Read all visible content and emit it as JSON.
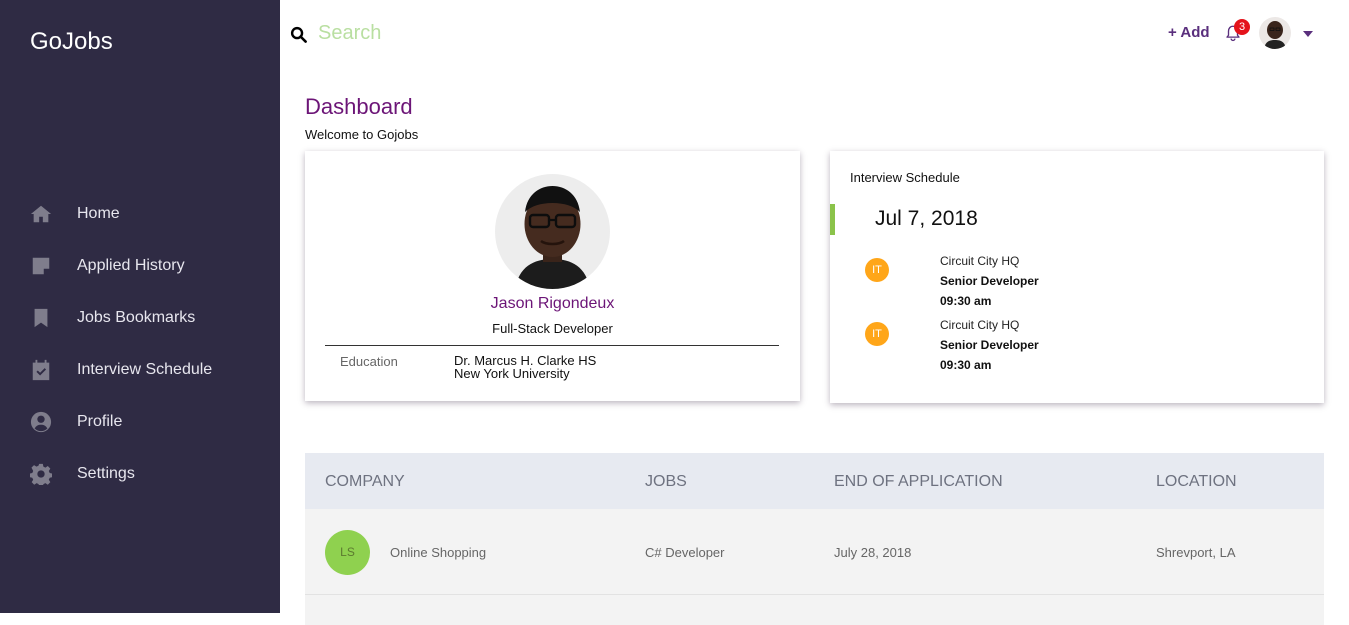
{
  "brand": "GoJobs",
  "nav": [
    {
      "label": "Home",
      "icon": "home-icon"
    },
    {
      "label": "Applied History",
      "icon": "note-icon"
    },
    {
      "label": "Jobs Bookmarks",
      "icon": "bookmark-icon"
    },
    {
      "label": "Interview Schedule",
      "icon": "calendar-check-icon"
    },
    {
      "label": "Profile",
      "icon": "account-icon"
    },
    {
      "label": "Settings",
      "icon": "gear-icon"
    }
  ],
  "topbar": {
    "search_placeholder": "Search",
    "add_label": "+ Add",
    "notification_count": "3"
  },
  "page": {
    "title": "Dashboard",
    "subtitle": "Welcome to Gojobs"
  },
  "profile": {
    "name": "Jason Rigondeux",
    "role": "Full-Stack Developer",
    "education_label": "Education",
    "education": [
      "Dr. Marcus H. Clarke HS",
      "New York University"
    ]
  },
  "interview": {
    "title": "Interview Schedule",
    "date": "Jul 7, 2018",
    "entries": [
      {
        "badge": "IT",
        "company": "Circuit City HQ",
        "position": "Senior Developer",
        "time": "09:30 am"
      },
      {
        "badge": "IT",
        "company": "Circuit City HQ",
        "position": "Senior Developer",
        "time": "09:30 am"
      }
    ]
  },
  "table": {
    "headers": [
      "COMPANY",
      "JOBS",
      "END OF APPLICATION",
      "LOCATION"
    ],
    "rows": [
      {
        "logo": "LS",
        "company": "Online Shopping",
        "job": "C# Developer",
        "end": "July 28, 2018",
        "location": "Shrevport, LA"
      }
    ]
  },
  "colors": {
    "sidebar": "#2f2b44",
    "accent_purple": "#6c1577",
    "accent_green": "#8bc34a",
    "badge_orange": "#ffa619",
    "notification_red": "#e4131b"
  }
}
